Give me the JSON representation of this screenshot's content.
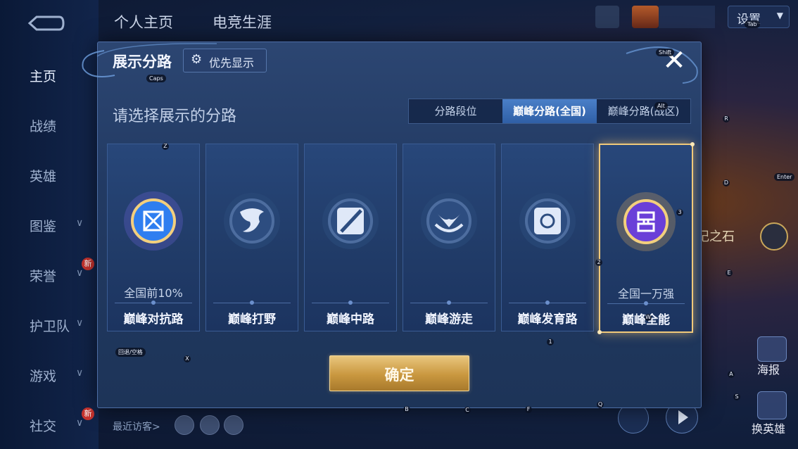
{
  "nav": {
    "items": [
      {
        "label": "主页",
        "active": true
      },
      {
        "label": "战绩",
        "active": false
      },
      {
        "label": "英雄",
        "active": false
      },
      {
        "label": "图鉴",
        "active": false,
        "chevron": true
      },
      {
        "label": "荣誉",
        "active": false,
        "chevron": true,
        "badge": "新"
      },
      {
        "label": "护卫队",
        "active": false,
        "chevron": true
      },
      {
        "label": "游戏",
        "active": false,
        "chevron": true
      },
      {
        "label": "社交",
        "active": false,
        "chevron": true,
        "badge": "新"
      }
    ]
  },
  "header": {
    "tabs": [
      "个人主页",
      "电竞生涯"
    ],
    "settings_label": "设置"
  },
  "background": {
    "stone_label": "记之石",
    "poster_label": "海报",
    "swap_hero_label": "换英雄",
    "recent_visitors_label": "最近访客>"
  },
  "modal": {
    "title": "展示分路",
    "pref_label": "优先显示",
    "close_glyph": "✕",
    "prompt": "请选择展示的分路",
    "segments": [
      {
        "label": "分路段位",
        "active": false
      },
      {
        "label": "巅峰分路(全国)",
        "active": true
      },
      {
        "label": "巅峰分路(战区)",
        "active": false
      }
    ],
    "cards": [
      {
        "name": "巅峰对抗路",
        "sub": "全国前10%",
        "icon": "lane-fighter-icon",
        "selected": false,
        "lit": true
      },
      {
        "name": "巅峰打野",
        "sub": "",
        "icon": "lane-jungle-icon",
        "selected": false,
        "lit": false
      },
      {
        "name": "巅峰中路",
        "sub": "",
        "icon": "lane-mid-icon",
        "selected": false,
        "lit": false
      },
      {
        "name": "巅峰游走",
        "sub": "",
        "icon": "lane-roam-icon",
        "selected": false,
        "lit": false
      },
      {
        "name": "巅峰发育路",
        "sub": "",
        "icon": "lane-marksman-icon",
        "selected": false,
        "lit": false
      },
      {
        "name": "巅峰全能",
        "sub": "全国一万强",
        "icon": "lane-allround-icon",
        "selected": true,
        "lit": true
      }
    ],
    "confirm_label": "确定"
  },
  "key_hints": {
    "caps": "Caps",
    "shift": "Shift",
    "alt": "Alt",
    "tab": "Tab",
    "enter": "Enter",
    "z": "Z",
    "x": "X",
    "r": "R",
    "d": "D",
    "e": "E",
    "a": "A",
    "s": "S",
    "q": "Q",
    "b": "B",
    "c": "C",
    "f": "F",
    "w": "W",
    "one": "1",
    "two": "2",
    "three": "3",
    "backspace": "回退/空格"
  },
  "colors": {
    "accent_gold": "#f0c97a",
    "panel_blue": "#223a63",
    "segment_active": "#3e72bb"
  }
}
